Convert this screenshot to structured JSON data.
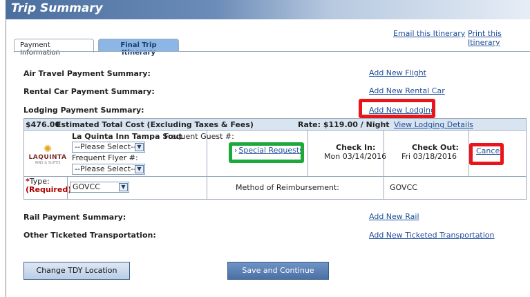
{
  "window": {
    "title": "Trip Summary"
  },
  "top_links": {
    "email": "Email this Itinerary",
    "print": "Print this Itinerary"
  },
  "tabs": [
    {
      "label": "Payment Information",
      "active": true
    },
    {
      "label": "Final Trip Itinerary",
      "active": false
    }
  ],
  "sections": {
    "air": {
      "label": "Air Travel Payment Summary:",
      "link": "Add New Flight"
    },
    "car": {
      "label": "Rental Car Payment Summary:",
      "link": "Add New Rental Car"
    },
    "lodging": {
      "label": "Lodging Payment Summary:",
      "link": "Add New Lodging"
    },
    "rail": {
      "label": "Rail Payment Summary:",
      "link": "Add New Rail"
    },
    "other": {
      "label": "Other Ticketed Transportation:",
      "link": "Add New Ticketed Transportation"
    }
  },
  "lodging": {
    "cost": "$476.00",
    "cost_label": "Estimated Total Cost (Excluding Taxes & Fees)",
    "rate": "Rate: $119.00 / Night",
    "view_details": "View Lodging Details",
    "logo": {
      "name": "LAQUINTA",
      "sub": "INNS & SUITES",
      "icon": "sun-icon"
    },
    "hotel_name": "La Quinta Inn Tampa Sout",
    "frequent_guest_label": "Frequent Guest #:",
    "frequent_guest_value": "--Please Select--",
    "frequent_flyer_label": "Frequent Flyer #:",
    "frequent_flyer_value": "--Please Select--",
    "special_requests": "Special Requests",
    "check_in_label": "Check In:",
    "check_in_value": "Mon 03/14/2016",
    "check_out_label": "Check Out:",
    "check_out_value": "Fri 03/18/2016",
    "cancel": "Cancel",
    "type_label": "Type:",
    "type_required_marker": "*",
    "type_required": "(Required)",
    "type_value": "GOVCC",
    "method_label": "Method of Reimbursement:",
    "method_value": "GOVCC"
  },
  "buttons": {
    "change_tdy": "Change TDY Location",
    "save_continue": "Save and Continue"
  },
  "colors": {
    "highlight_red": "#e8161b",
    "highlight_green": "#1da83a",
    "link": "#1f4e9a",
    "required": "#b00000"
  }
}
